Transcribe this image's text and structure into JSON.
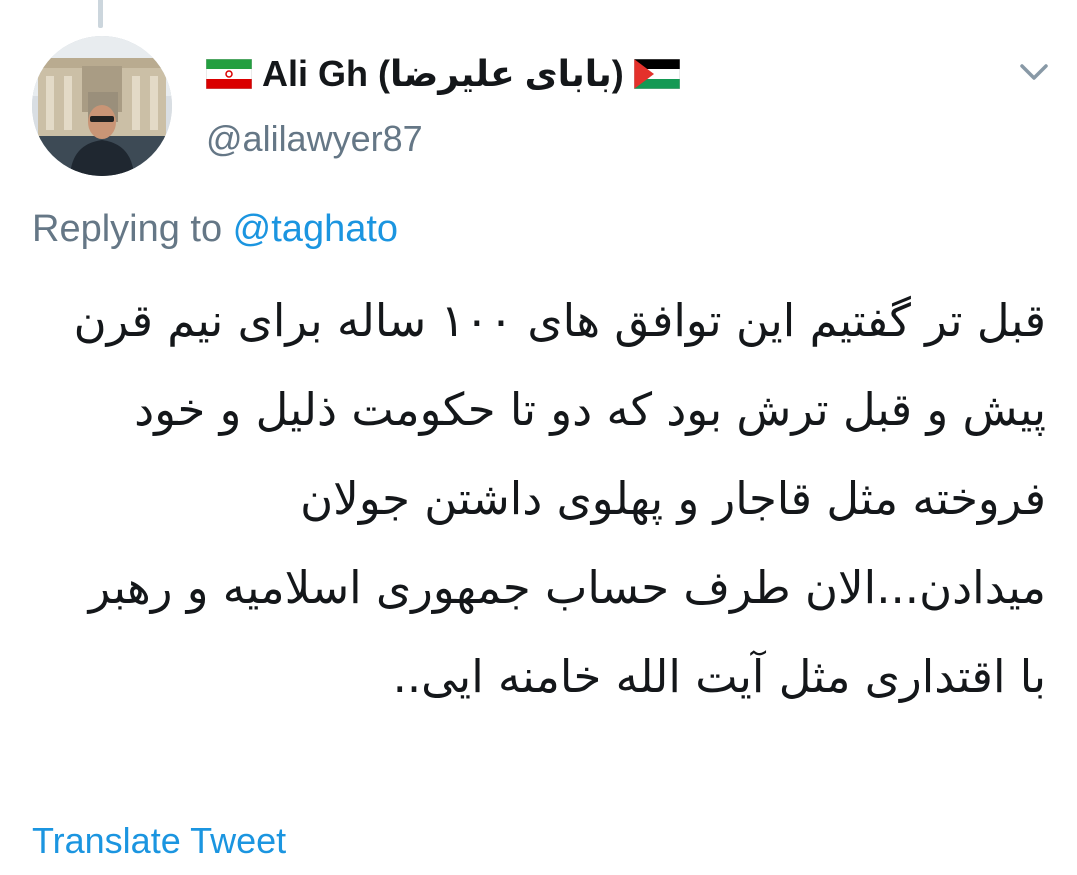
{
  "tweet": {
    "author": {
      "name": "Ali Gh (بابای علیرضا)",
      "handle": "@alilawyer87",
      "avatar": "profile-photo",
      "flag_left": "iran-flag-icon",
      "flag_right": "palestine-flag-icon"
    },
    "menu_icon": "chevron-down-icon",
    "reply": {
      "prefix": "Replying to ",
      "mention": "@taghato"
    },
    "text": "قبل تر گفتیم این توافق های ۱۰۰ ساله برای نیم قرن پیش و قبل ترش بود که دو تا حکومت ذلیل و خود فروخته مثل قاجار و پهلوی داشتن جولان میدادن...الان طرف حساب جمهوری اسلامیه و رهبر با اقتداری مثل آیت الله خامنه ایی..",
    "translate_label": "Translate Tweet"
  },
  "colors": {
    "text_primary": "#14171a",
    "text_secondary": "#657786",
    "link": "#1b95e0",
    "thread_line": "#ccd6dd"
  }
}
